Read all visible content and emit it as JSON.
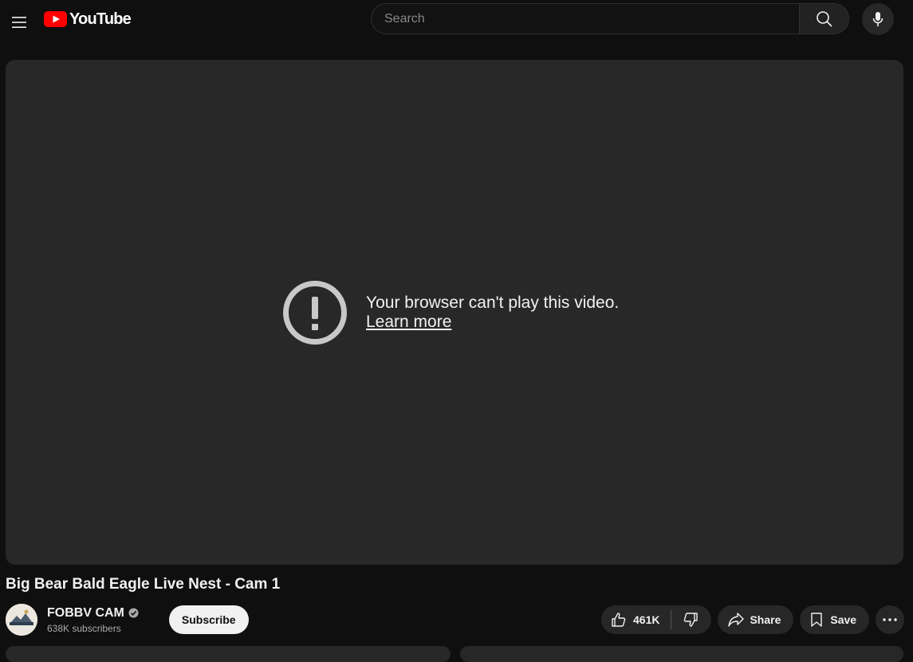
{
  "header": {
    "logo_text": "YouTube",
    "search_placeholder": "Search",
    "brand_color": "#ff0000"
  },
  "player": {
    "error_message": "Your browser can't play this video.",
    "learn_more": "Learn more"
  },
  "video": {
    "title": "Big Bear Bald Eagle Live Nest - Cam 1"
  },
  "channel": {
    "name": "FOBBV CAM",
    "subscribers": "638K subscribers",
    "verified": true,
    "subscribe_label": "Subscribe"
  },
  "actions": {
    "like_count": "461K",
    "share_label": "Share",
    "save_label": "Save"
  },
  "icons": [
    "menu-icon",
    "youtube-logo-icon",
    "search-icon",
    "mic-icon",
    "alert-icon",
    "verified-icon",
    "like-icon",
    "dislike-icon",
    "share-icon",
    "save-icon",
    "more-icon"
  ]
}
